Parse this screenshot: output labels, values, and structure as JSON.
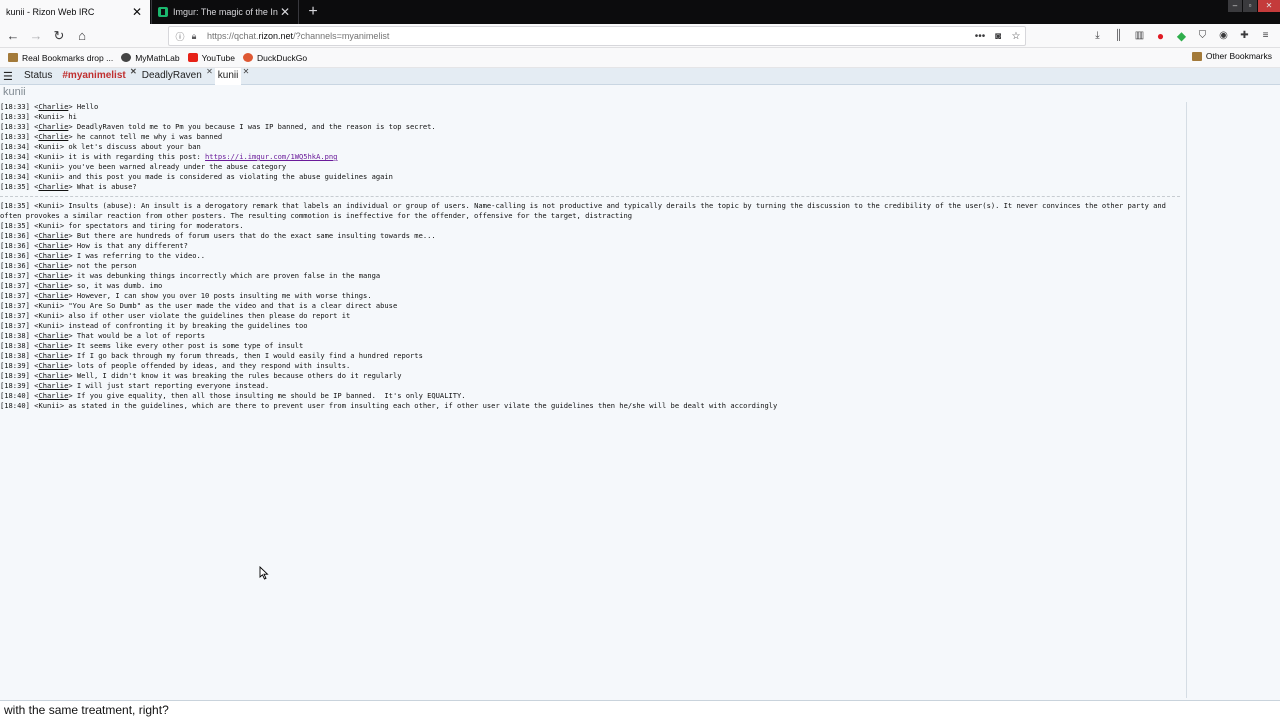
{
  "browser": {
    "tabs": [
      {
        "title": "kunii - Rizon Web IRC",
        "active": true
      },
      {
        "title": "Imgur: The magic of the Intern",
        "active": false
      }
    ],
    "url_prefix": "https://qchat.",
    "url_domain": "rizon.net",
    "url_suffix": "/?channels=myanimelist",
    "bookmarks": [
      {
        "label": "Real Bookmarks drop ...",
        "icon": "folder-icon"
      },
      {
        "label": "MyMathLab",
        "icon": "mymathlab-icon"
      },
      {
        "label": "YouTube",
        "icon": "youtube-icon"
      },
      {
        "label": "DuckDuckGo",
        "icon": "duckduckgo-icon"
      }
    ],
    "other_bookmarks": "Other Bookmarks"
  },
  "irc": {
    "tabs": [
      {
        "label": "Status",
        "closable": false
      },
      {
        "label": "#myanimelist",
        "closable": true
      },
      {
        "label": "DeadlyRaven",
        "closable": true
      },
      {
        "label": "kunii",
        "closable": true
      }
    ],
    "window_title": "kunii",
    "input_value": "with the same treatment, right?"
  },
  "messages_before": [
    {
      "time": "[18:33]",
      "nick": "Charlie",
      "text": "Hello"
    },
    {
      "time": "[18:33]",
      "nick": "Kunii",
      "text": "hi"
    },
    {
      "time": "[18:33]",
      "nick": "Charlie",
      "text": "DeadlyRaven told me to Pm you because I was IP banned, and the reason is top secret."
    },
    {
      "time": "[18:33]",
      "nick": "Charlie",
      "text": "he cannot tell me why i was banned"
    },
    {
      "time": "[18:34]",
      "nick": "Kunii",
      "text": "ok let's discuss about your ban"
    },
    {
      "time": "[18:34]",
      "nick": "Kunii",
      "text": "it is with regarding this post: ",
      "link": "https://i.imgur.com/1WQ5hkA.png"
    },
    {
      "time": "[18:34]",
      "nick": "Kunii",
      "text": "you've been warned already under the abuse category"
    },
    {
      "time": "[18:34]",
      "nick": "Kunii",
      "text": "and this post you made is considered as violating the abuse guidelines again"
    },
    {
      "time": "[18:35]",
      "nick": "Charlie",
      "text": "What is abuse?"
    }
  ],
  "messages_after": [
    {
      "time": "[18:35]",
      "nick": "Kunii",
      "text": "Insults (abuse): An insult is a derogatory remark that labels an individual or group of users. Name-calling is not productive and typically derails the topic by turning the discussion to the credibility of the user(s). It never convinces the other party and often provokes a similar reaction from other posters. The resulting commotion is ineffective for the offender, offensive for the target, distracting",
      "wrap": true
    },
    {
      "time": "[18:35]",
      "nick": "Kunii",
      "text": "for spectators and tiring for moderators."
    },
    {
      "time": "[18:36]",
      "nick": "Charlie",
      "text": "But there are hundreds of forum users that do the exact same insulting towards me..."
    },
    {
      "time": "[18:36]",
      "nick": "Charlie",
      "text": "How is that any different?"
    },
    {
      "time": "[18:36]",
      "nick": "Charlie",
      "text": "I was referring to the video.."
    },
    {
      "time": "[18:36]",
      "nick": "Charlie",
      "text": "not the person"
    },
    {
      "time": "[18:37]",
      "nick": "Charlie",
      "text": "it was debunking things incorrectly which are proven false in the manga"
    },
    {
      "time": "[18:37]",
      "nick": "Charlie",
      "text": "so, it was dumb. imo"
    },
    {
      "time": "[18:37]",
      "nick": "Charlie",
      "text": "However, I can show you over 10 posts insulting me with worse things."
    },
    {
      "time": "[18:37]",
      "nick": "Kunii",
      "text": "\"You Are So Dumb\" as the user made the video and that is a clear direct abuse"
    },
    {
      "time": "[18:37]",
      "nick": "Kunii",
      "text": "also if other user violate the guidelines then please do report it"
    },
    {
      "time": "[18:37]",
      "nick": "Kunii",
      "text": "instead of confronting it by breaking the guidelines too"
    },
    {
      "time": "[18:38]",
      "nick": "Charlie",
      "text": "That would be a lot of reports"
    },
    {
      "time": "[18:38]",
      "nick": "Charlie",
      "text": "It seems like every other post is some type of insult"
    },
    {
      "time": "[18:38]",
      "nick": "Charlie",
      "text": "If I go back through my forum threads, then I would easily find a hundred reports"
    },
    {
      "time": "[18:39]",
      "nick": "Charlie",
      "text": "lots of people offended by ideas, and they respond with insults."
    },
    {
      "time": "[18:39]",
      "nick": "Charlie",
      "text": "Well, I didn't know it was breaking the rules because others do it regularly"
    },
    {
      "time": "[18:39]",
      "nick": "Charlie",
      "text": "I will just start reporting everyone instead."
    },
    {
      "time": "[18:40]",
      "nick": "Charlie",
      "text": "If you give equality, then all those insulting me should be IP banned.  It's only EQUALITY."
    },
    {
      "time": "[18:40]",
      "nick": "Kunii",
      "text": "as stated in the guidelines, which are there to prevent user from insulting each other, if other user vilate the guidelines then he/she will be dealt with accordingly"
    }
  ]
}
